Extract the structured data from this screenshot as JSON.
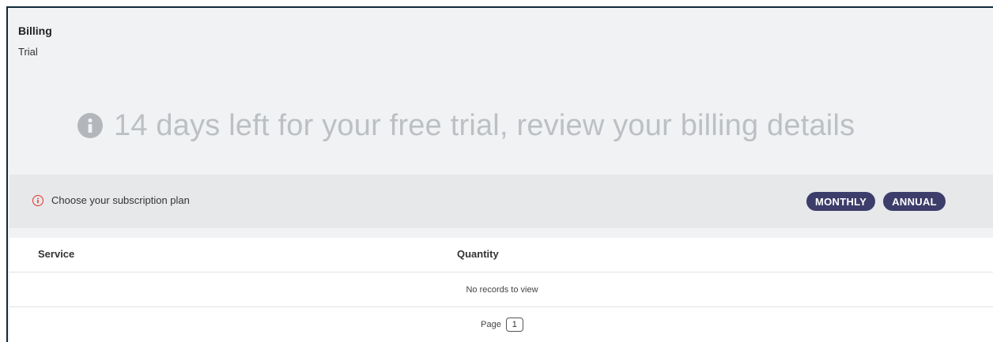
{
  "header": {
    "title": "Billing",
    "subtitle": "Trial"
  },
  "banner": {
    "icon": "info-icon",
    "text": "14 days left for your free trial, review your billing details"
  },
  "plan": {
    "alert_icon": "alert-circle-icon",
    "prompt": "Choose your subscription plan",
    "buttons": {
      "monthly": "MONTHLY",
      "annual": "ANNUAL"
    }
  },
  "grid": {
    "columns": [
      "Service",
      "Quantity"
    ],
    "empty_message": "No records to view",
    "pager": {
      "label": "Page",
      "current_page": "1"
    }
  },
  "colors": {
    "pill_button": "#3d3d6b",
    "alert": "#e0352b",
    "banner_text": "#bcc0c4"
  }
}
